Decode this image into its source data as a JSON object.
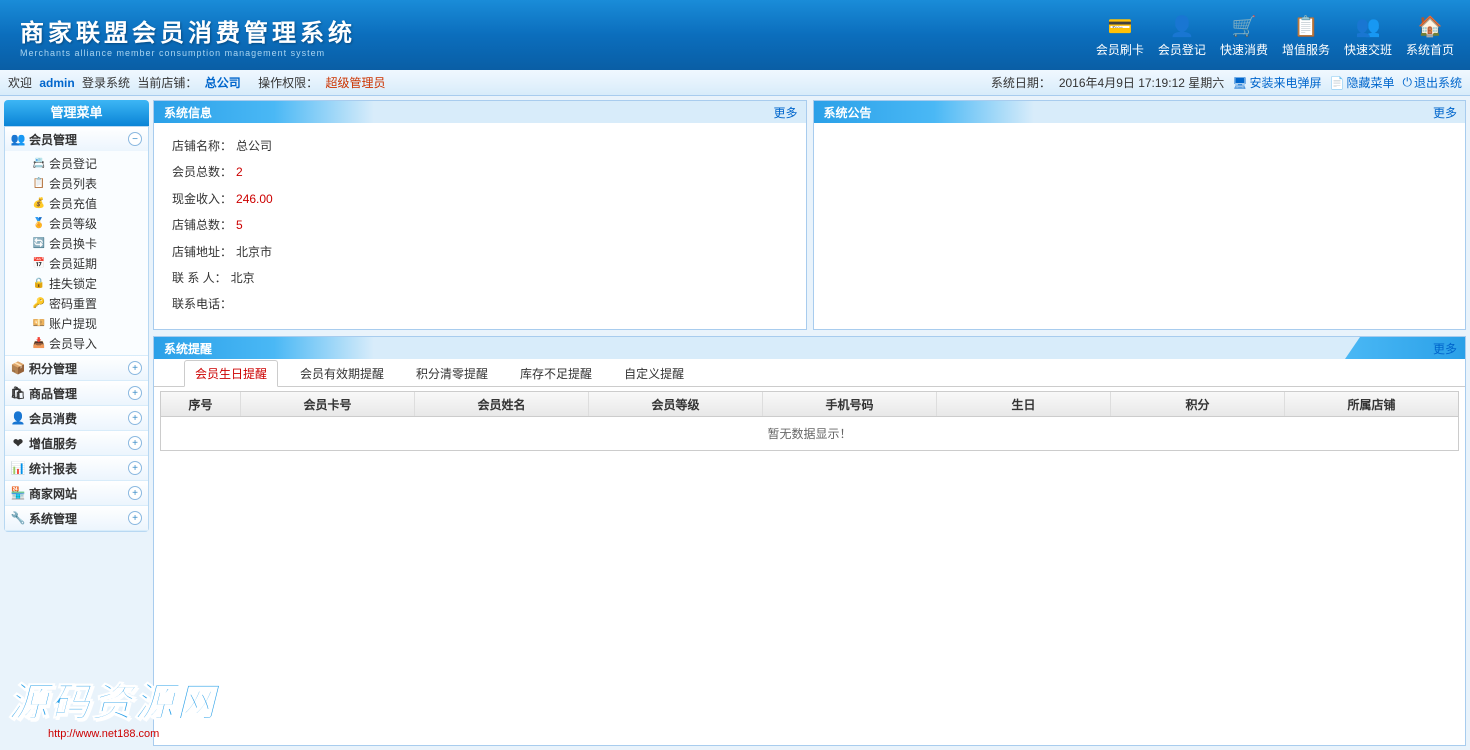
{
  "header": {
    "title_cn": "商家联盟会员消费管理系统",
    "title_en": "Merchants alliance member consumption management system",
    "actions": [
      {
        "label": "会员刷卡",
        "icon": "💳"
      },
      {
        "label": "会员登记",
        "icon": "👤"
      },
      {
        "label": "快速消费",
        "icon": "🛒"
      },
      {
        "label": "增值服务",
        "icon": "📋"
      },
      {
        "label": "快速交班",
        "icon": "👥"
      },
      {
        "label": "系统首页",
        "icon": "🏠"
      }
    ]
  },
  "infobar": {
    "welcome": "欢迎",
    "user": "admin",
    "login_sys": "登录系统",
    "cur_shop_label": "当前店铺：",
    "cur_shop": "总公司",
    "perm_label": "操作权限：",
    "perm": "超级管理员",
    "date_label": "系统日期：",
    "date_value": "2016年4月9日 17:19:12 星期六",
    "install": "安装来电弹屏",
    "hide_menu": "隐藏菜单",
    "exit": "退出系统"
  },
  "sidebar": {
    "title": "管理菜单",
    "groups": [
      {
        "label": "会员管理",
        "icon": "👥",
        "expanded": true,
        "items": [
          {
            "label": "会员登记",
            "icon": "📇",
            "color": "#6a6"
          },
          {
            "label": "会员列表",
            "icon": "📋",
            "color": "#e90"
          },
          {
            "label": "会员充值",
            "icon": "💰",
            "color": "#e90"
          },
          {
            "label": "会员等级",
            "icon": "🏅",
            "color": "#e90"
          },
          {
            "label": "会员换卡",
            "icon": "🔄",
            "color": "#6a6"
          },
          {
            "label": "会员延期",
            "icon": "📅",
            "color": "#c33"
          },
          {
            "label": "挂失锁定",
            "icon": "🔒",
            "color": "#e90"
          },
          {
            "label": "密码重置",
            "icon": "🔑",
            "color": "#888"
          },
          {
            "label": "账户提现",
            "icon": "💴",
            "color": "#6a6"
          },
          {
            "label": "会员导入",
            "icon": "📥",
            "color": "#6a6"
          }
        ]
      },
      {
        "label": "积分管理",
        "icon": "📦",
        "expanded": false
      },
      {
        "label": "商品管理",
        "icon": "🛍",
        "expanded": false
      },
      {
        "label": "会员消费",
        "icon": "👤",
        "expanded": false
      },
      {
        "label": "增值服务",
        "icon": "❤",
        "expanded": false
      },
      {
        "label": "统计报表",
        "icon": "📊",
        "expanded": false
      },
      {
        "label": "商家网站",
        "icon": "🏪",
        "expanded": false
      },
      {
        "label": "系统管理",
        "icon": "🔧",
        "expanded": false
      }
    ]
  },
  "sysinfo": {
    "title": "系统信息",
    "more": "更多",
    "fields": [
      {
        "label": "店铺名称：",
        "value": "总公司"
      },
      {
        "label": "会员总数：",
        "value": "2",
        "red": true
      },
      {
        "label": "现金收入：",
        "value": "246.00",
        "red": true
      },
      {
        "label": "店铺总数：",
        "value": "5",
        "red": true
      },
      {
        "label": "店铺地址：",
        "value": "北京市"
      },
      {
        "label": "联 系 人：",
        "value": "北京"
      },
      {
        "label": "联系电话：",
        "value": ""
      }
    ]
  },
  "notice": {
    "title": "系统公告",
    "more": "更多"
  },
  "reminder": {
    "title": "系统提醒",
    "more": "更多",
    "tabs": [
      "会员生日提醒",
      "会员有效期提醒",
      "积分清零提醒",
      "库存不足提醒",
      "自定义提醒"
    ],
    "active_tab": 0,
    "columns": [
      "序号",
      "会员卡号",
      "会员姓名",
      "会员等级",
      "手机号码",
      "生日",
      "积分",
      "所属店铺"
    ],
    "empty": "暂无数据显示！"
  },
  "watermark": {
    "big": "源码资源网",
    "url": "http://www.net188.com"
  }
}
